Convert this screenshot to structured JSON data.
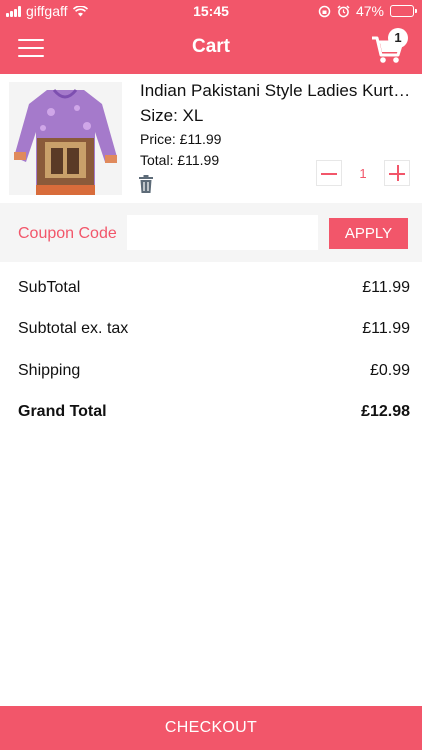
{
  "theme": {
    "accent": "#f2566a",
    "divider": "#e8e8e8",
    "muted_icon": "#5d6b78"
  },
  "status_bar": {
    "carrier": "giffgaff",
    "time": "15:45",
    "battery": "47%",
    "battery_level": 0.47,
    "icons": [
      "signal-icon",
      "wifi-icon",
      "orientation-lock-icon",
      "alarm-icon",
      "battery-icon"
    ]
  },
  "header": {
    "title": "Cart",
    "cart_count": "1",
    "icons": [
      "menu-icon",
      "cart-icon"
    ]
  },
  "cart_item": {
    "title": "Indian Pakistani Style Ladies Kurti Top",
    "size": "Size: XL",
    "price": "Price: £11.99",
    "total": "Total: £11.99",
    "quantity": "1",
    "icons": [
      "delete-icon",
      "minus-icon",
      "plus-icon"
    ]
  },
  "coupon": {
    "label": "Coupon Code",
    "value": "",
    "placeholder": "",
    "button_label": "APPLY"
  },
  "totals": {
    "subtotal": {
      "label": "SubTotal",
      "value": "£11.99"
    },
    "subtotal_ex_tax": {
      "label": "Subtotal ex. tax",
      "value": "£11.99"
    },
    "shipping": {
      "label": "Shipping",
      "value": "£0.99"
    },
    "grand_total": {
      "label": "Grand Total",
      "value": "£12.98"
    }
  },
  "footer": {
    "checkout_label": "CHECKOUT"
  }
}
